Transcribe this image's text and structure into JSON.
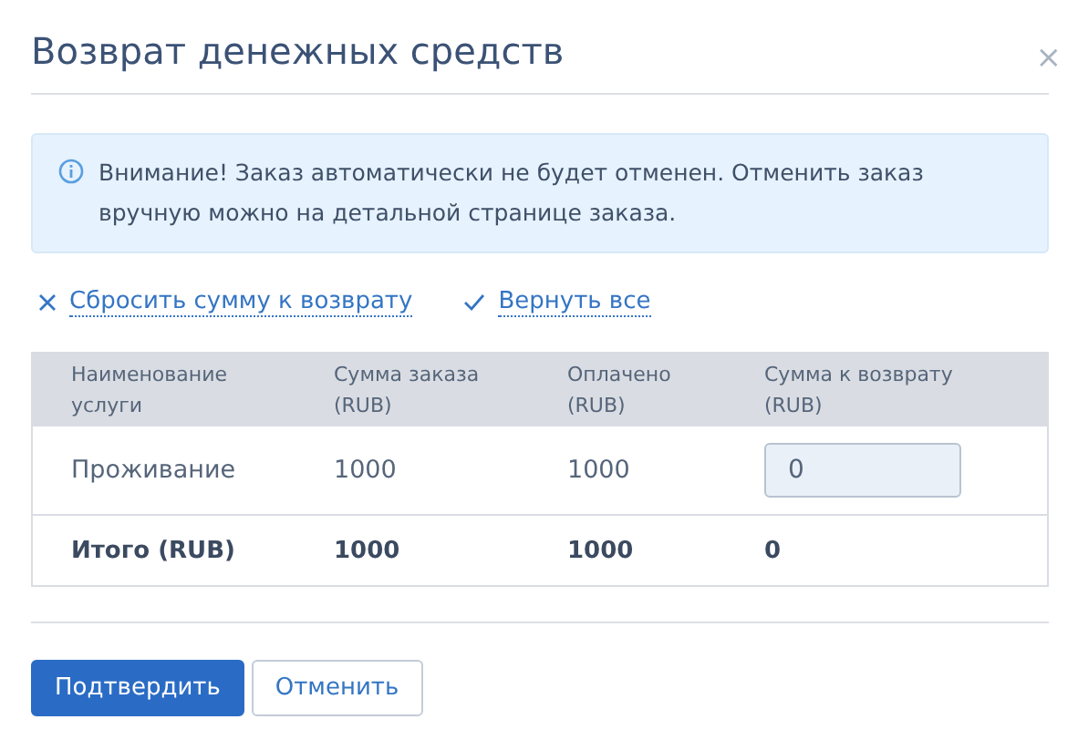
{
  "dialog": {
    "title": "Возврат денежных средств",
    "close": "×"
  },
  "alert": {
    "text": "Внимание! Заказ автоматически не будет отменен. Отменить заказ вручную можно на детальной странице заказа."
  },
  "actions": [
    {
      "kind": "reset",
      "label": "Сбросить сумму к возврату"
    },
    {
      "kind": "all",
      "label": "Вернуть все"
    }
  ],
  "table": {
    "columns": [
      "Наименование услуги",
      "Сумма заказа (RUB)",
      "Оплачено (RUB)",
      "Сумма к возврату (RUB)"
    ],
    "rows": [
      {
        "service": "Проживание",
        "order_sum": "1000",
        "paid": "1000",
        "refund": "0"
      }
    ],
    "total": {
      "label": "Итого (RUB)",
      "order_sum": "1000",
      "paid": "1000",
      "refund": "0"
    }
  },
  "buttons": [
    {
      "kind": "primary",
      "label": "Подтвердить"
    },
    {
      "kind": "secondary",
      "label": "Отменить"
    }
  ]
}
